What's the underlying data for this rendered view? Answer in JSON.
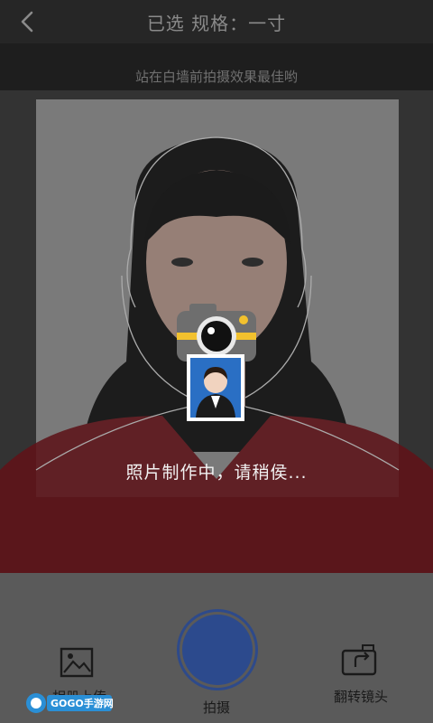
{
  "header": {
    "title": "已选 规格：一寸"
  },
  "hint": "站在白墙前拍摄效果最佳哟",
  "status": "照片制作中，请稍侯...",
  "bottom": {
    "album_label": "相册上传",
    "shutter_label": "拍摄",
    "flip_label": "翻转镜头"
  },
  "watermark": "GOGO手游网",
  "colors": {
    "accent": "#2c4a8d",
    "camera_body": "#6e6e6e",
    "camera_stripe": "#f2c12e",
    "id_photo_bg": "#2a6fc4"
  },
  "icons": [
    "back-chevron-icon",
    "camera-icon",
    "id-photo-icon",
    "album-icon",
    "flip-camera-icon"
  ]
}
